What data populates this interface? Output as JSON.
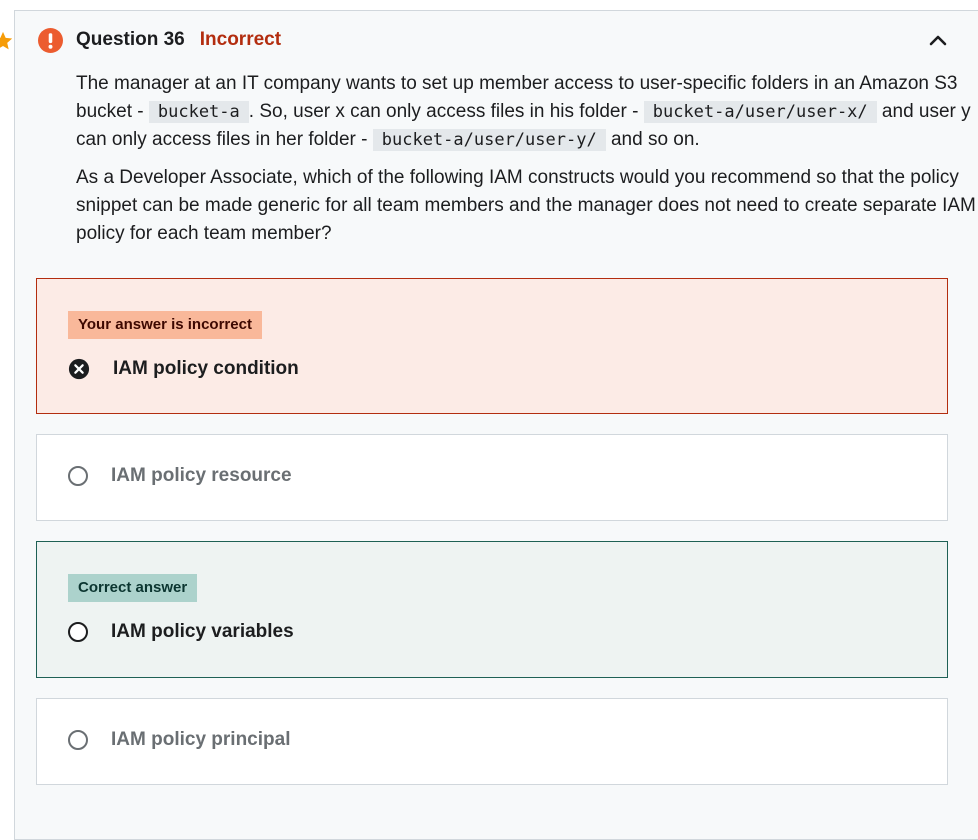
{
  "question": {
    "number_label": "Question 36",
    "status": "Incorrect",
    "paragraph1": {
      "t1": "The manager at an IT company wants to set up member access to user-specific folders in an Amazon S3 bucket - ",
      "code1": "bucket-a",
      "t2": ". So, user x can only access files in his folder - ",
      "code2": "bucket-a/user/user-x/",
      "t3": " and user y can only access files in her folder - ",
      "code3": "bucket-a/user/user-y/",
      "t4": " and so on."
    },
    "paragraph2": "As a Developer Associate, which of the following IAM constructs would you recommend so that the policy snippet can be made generic for all team members and the manager does not need to create separate IAM policy for each team member?"
  },
  "options": [
    {
      "label": "IAM policy condition",
      "badge": "Your answer is incorrect",
      "state": "selected-incorrect"
    },
    {
      "label": "IAM policy resource",
      "state": "unselected"
    },
    {
      "label": "IAM policy variables",
      "badge": "Correct answer",
      "state": "correct"
    },
    {
      "label": "IAM policy principal",
      "state": "unselected"
    }
  ],
  "icons": {
    "star": "star-icon",
    "alert": "exclamation-circle-icon",
    "collapse": "chevron-up-icon",
    "wrong": "x-circle-icon"
  },
  "colors": {
    "incorrect_text": "#b32d0f",
    "incorrect_bg": "#fcebe6",
    "incorrect_badge": "#f9b89a",
    "correct_bg": "#eef3f2",
    "correct_border": "#1e6055",
    "correct_badge": "#acd2cc",
    "star": "#f69c08"
  }
}
